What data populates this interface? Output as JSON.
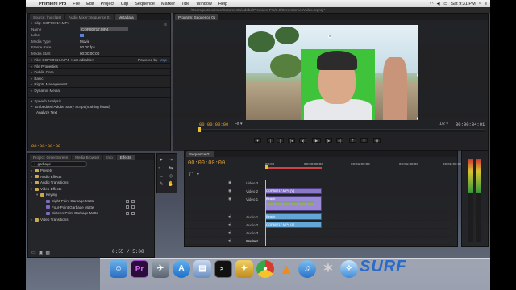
{
  "menubar": {
    "app": "Premiere Pro",
    "items": [
      "File",
      "Edit",
      "Project",
      "Clip",
      "Sequence",
      "Marker",
      "Title",
      "Window",
      "Help"
    ],
    "clock": "Sat 9:31 PM"
  },
  "path_title": "/Users/justinodisho/Documents/Adobe/Premiere Pro/6.0/GreenScreenVideo.prproj *",
  "source_panel": {
    "tabs": [
      "Source: (no clips)",
      "Audio Mixer: Sequence 01",
      "Metadata"
    ],
    "clip_header": "Clip: COP80717.MP4",
    "rows": [
      {
        "key": "Name",
        "value": "COP80717.MP4"
      },
      {
        "key": "Label",
        "value": ""
      },
      {
        "key": "Media Type",
        "value": "Movie"
      },
      {
        "key": "Frame Rate",
        "value": "50.00 fps"
      },
      {
        "key": "Media Start",
        "value": "00:00:00:00"
      }
    ],
    "file_header": "File: COP80717.MP4 <Not editable>",
    "powered": "Powered by",
    "xmp": "xmp",
    "sections": [
      "File Properties",
      "Dublin Core",
      "Basic",
      "Rights Management",
      "Dynamic Media"
    ],
    "speech_header": "Speech Analysis",
    "speech_item": "Embedded Adobe Story Script (nothing found)",
    "analyze": "Analyze Text",
    "timecode": "00:00:00:00"
  },
  "program_monitor": {
    "tab": "Program: Sequence 01",
    "timecode_in": "00:00:00:00",
    "fit": "Fit",
    "zoom": "1/2",
    "timecode_out": "00:00:34:01"
  },
  "effects_panel": {
    "tabs": [
      "Project: GreenScreen",
      "Media Browser",
      "Info",
      "Effects"
    ],
    "search_value": "garbage",
    "tree": [
      {
        "label": "Presets",
        "kind": "folder",
        "indent": 0
      },
      {
        "label": "Audio Effects",
        "kind": "folder",
        "indent": 0
      },
      {
        "label": "Audio Transitions",
        "kind": "folder",
        "indent": 0
      },
      {
        "label": "Video Effects",
        "kind": "folder",
        "indent": 0
      },
      {
        "label": "Keying",
        "kind": "folder",
        "indent": 1
      },
      {
        "label": "Eight-Point Garbage Matte",
        "kind": "effect",
        "indent": 2
      },
      {
        "label": "Four-Point Garbage Matte",
        "kind": "effect",
        "indent": 2
      },
      {
        "label": "Sixteen-Point Garbage Matte",
        "kind": "effect",
        "indent": 2
      },
      {
        "label": "Video Transitions",
        "kind": "folder",
        "indent": 0
      }
    ],
    "page": "0:55 / 5:00"
  },
  "timeline": {
    "tab": "Sequence 01",
    "timecode": "00:00:00:00",
    "ruler": [
      "00:00",
      "00:00:30:00",
      "00:01:00:00",
      "00:01:30:00",
      "00:02:00:00"
    ],
    "tracks": [
      "Video 3",
      "Video 2",
      "Video 1",
      "Audio 1",
      "Audio 2",
      "Audio 3",
      "Audio 4",
      "Master"
    ],
    "clip_v2": "COP80717.MP4 [V]",
    "clip_v1": "Beach",
    "clip_a1": "COP80717.MP4 [A]",
    "clip_a_label": "Beach"
  },
  "dock": {
    "apps": [
      "Finder",
      "Premiere Pro",
      "Launchpad",
      "App Store",
      "Preview",
      "Terminal",
      "Toolbox",
      "Chrome",
      "VLC",
      "iTunes",
      "Utilities",
      "Safari",
      "Other"
    ],
    "watermark": "SURF"
  }
}
